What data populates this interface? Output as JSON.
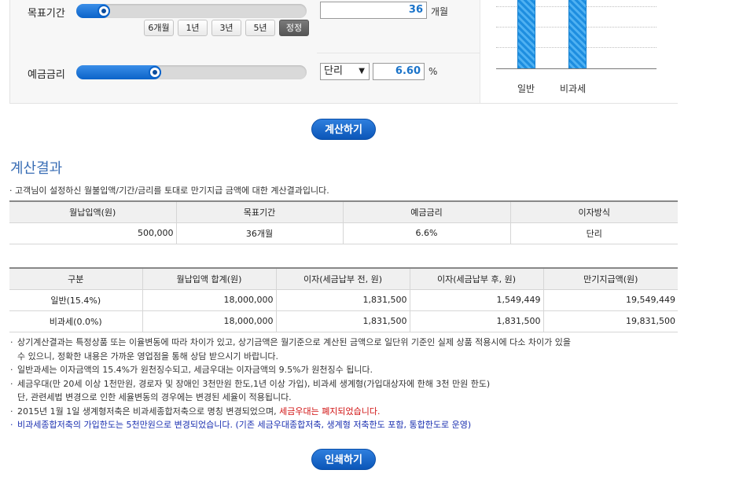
{
  "form": {
    "period": {
      "label": "목표기간",
      "value": "36",
      "unit": "개월",
      "level_fraction": 0.12,
      "buttons": [
        "6개월",
        "1년",
        "3년",
        "5년",
        "정정"
      ],
      "active_button": "정정"
    },
    "rate": {
      "label": "예금금리",
      "level_fraction": 0.34,
      "method": "단리",
      "value": "6.60",
      "unit": "%"
    }
  },
  "mini_chart": {
    "categories": [
      "일반",
      "비과세"
    ],
    "values": [
      19549449,
      19831500
    ]
  },
  "calc_button": "계산하기",
  "result": {
    "title": "계산결과",
    "description": "고객님이 설정하신 월불입액/기간/금리를 토대로 만기지급 금액에 대한 계산결과입니다.",
    "summary": {
      "headers": [
        "월납입액(원)",
        "목표기간",
        "예금금리",
        "이자방식"
      ],
      "row": [
        "500,000",
        "36개월",
        "6.6%",
        "단리"
      ]
    },
    "detail": {
      "headers": [
        "구분",
        "월납입액 합계(원)",
        "이자(세금납부 전, 원)",
        "이자(세금납부 후, 원)",
        "만기지급액(원)"
      ],
      "rows": [
        [
          "일반(15.4%)",
          "18,000,000",
          "1,831,500",
          "1,549,449",
          "19,549,449"
        ],
        [
          "비과세(0.0%)",
          "18,000,000",
          "1,831,500",
          "1,831,500",
          "19,831,500"
        ]
      ]
    }
  },
  "notes": {
    "n1a": "상기계산결과는 특정상품 또는 이율변동에 따라 차이가 있고, 상기금액은 월기준으로 계산된 금액으로 일단위 기준인 실제 상품 적용시에 다소 차이가 있을",
    "n1b": "수 있으니, 정확한 내용은 가까운 영업점을 통해 상담 받으시기 바랍니다.",
    "n2": "일반과세는 이자금액의 15.4%가 원천징수되고, 세금우대는 이자금액의 9.5%가 원천징수 됩니다.",
    "n3a": "세금우대(만 20세 이상 1천만원, 경로자 및 장애인 3천만원 한도,1년 이상 가입), 비과세 생계형(가입대상자에 한해 3천 만원 한도)",
    "n3b": "단, 관련세법 변경으로 인한 세율변동의 경우에는 변경된 세율이 적용됩니다.",
    "n4": "2015년 1월 1일 생계형저축은 비과세종합저축으로 명칭 변경되었으며, ",
    "n4_red": "세금우대는 폐지되었습니다.",
    "n5": "비과세종합저축의 가입한도는 5천만원으로 변경되었습니다. (기존 세금우대종합저축, 생계형 저축한도 포함, 통합한도로 운영)"
  },
  "print_button": "인쇄하기",
  "colors": {
    "accent": "#0b63c9",
    "title": "#3a6eb5",
    "warning": "#d01010",
    "note_blue": "#1a2fb0"
  }
}
